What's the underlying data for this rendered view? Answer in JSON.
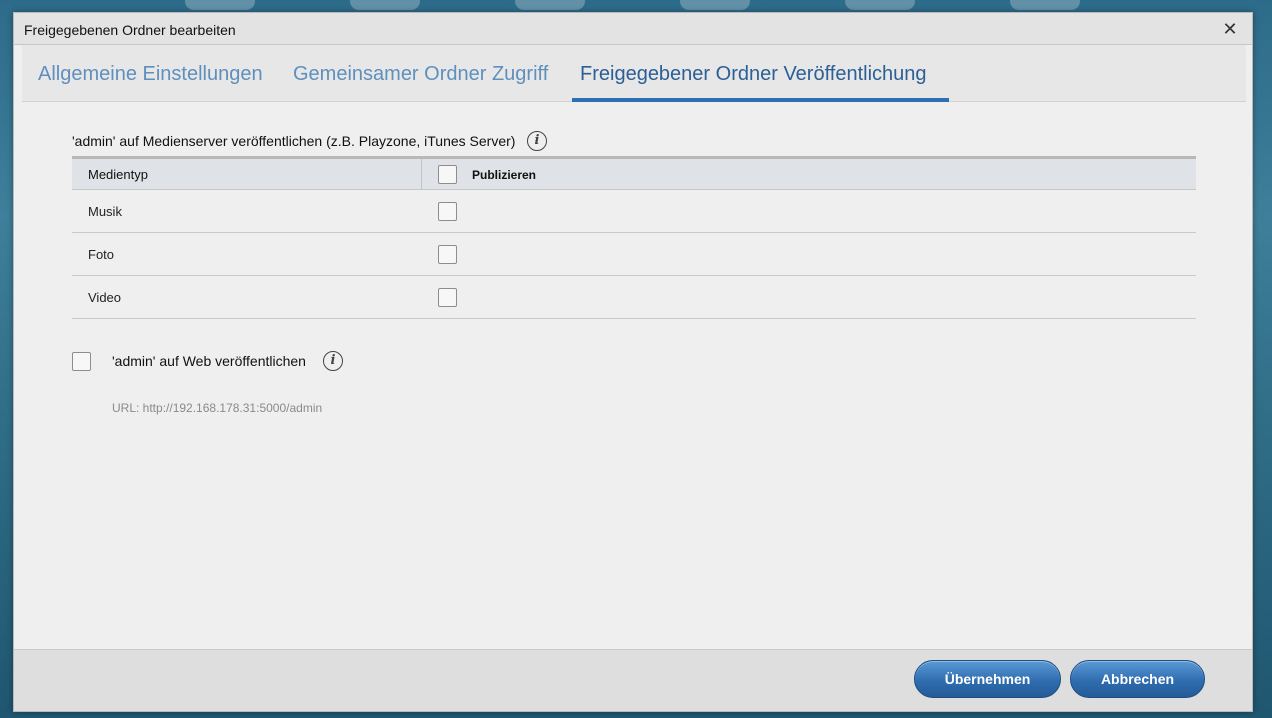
{
  "dialog": {
    "title": "Freigegebenen Ordner bearbeiten",
    "close_glyph": "✕"
  },
  "tabs": [
    {
      "label": "Allgemeine Einstellungen",
      "active": false
    },
    {
      "label": "Gemeinsamer Ordner Zugriff",
      "active": false
    },
    {
      "label": "Freigegebener Ordner Veröffentlichung",
      "active": true
    }
  ],
  "media_server": {
    "label": "'admin' auf Medienserver veröffentlichen (z.B. Playzone, iTunes Server)",
    "info_icon": "i",
    "columns": {
      "type": "Medientyp",
      "publish": "Publizieren"
    },
    "rows": [
      {
        "type": "Musik",
        "checked": false
      },
      {
        "type": "Foto",
        "checked": false
      },
      {
        "type": "Video",
        "checked": false
      }
    ]
  },
  "web": {
    "label": "'admin' auf Web veröffentlichen",
    "checked": false,
    "info_icon": "i",
    "url": "URL: http://192.168.178.31:5000/admin"
  },
  "footer": {
    "apply_label": "Übernehmen",
    "cancel_label": "Abbrechen"
  },
  "colors": {
    "accent": "#2e6fb3",
    "tab_inactive": "#5f8fbd",
    "button": "#2f6db0"
  }
}
